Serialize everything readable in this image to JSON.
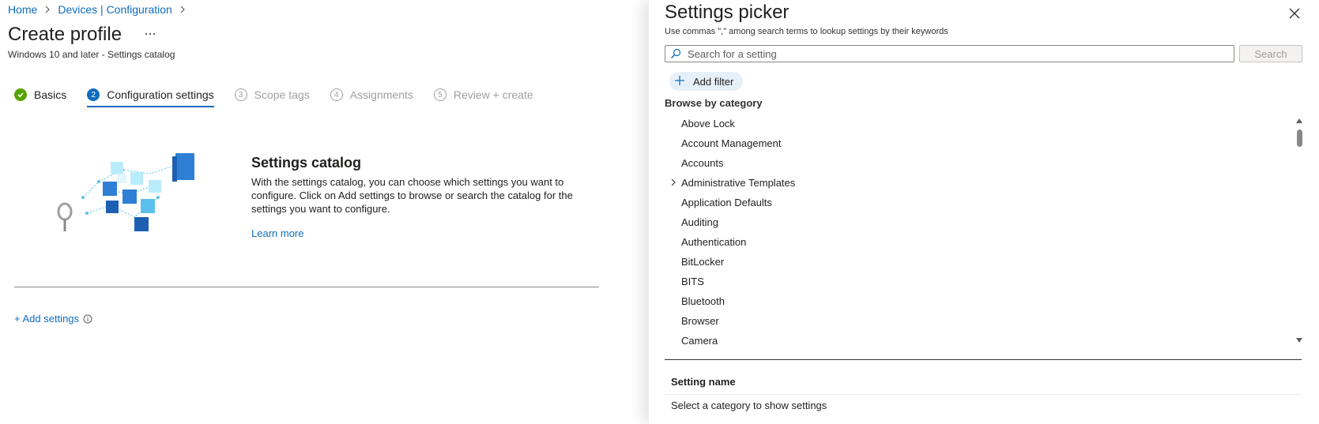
{
  "breadcrumb": {
    "home": "Home",
    "devices": "Devices | Configuration"
  },
  "page": {
    "title": "Create profile",
    "subtitle": "Windows 10 and later - Settings catalog"
  },
  "steps": [
    {
      "num": "✓",
      "label": "Basics",
      "state": "done"
    },
    {
      "num": "2",
      "label": "Configuration settings",
      "state": "active"
    },
    {
      "num": "3",
      "label": "Scope tags",
      "state": "pending"
    },
    {
      "num": "4",
      "label": "Assignments",
      "state": "pending"
    },
    {
      "num": "5",
      "label": "Review + create",
      "state": "pending"
    }
  ],
  "catalog": {
    "title": "Settings catalog",
    "description": "With the settings catalog, you can choose which settings you want to configure. Click on Add settings to browse or search the catalog for the settings you want to configure.",
    "learn_more": "Learn more",
    "add_settings": "+ Add settings"
  },
  "picker": {
    "title": "Settings picker",
    "hint": "Use commas \",\" among search terms to lookup settings by their keywords",
    "search_placeholder": "Search for a setting",
    "search_button": "Search",
    "add_filter": "Add filter",
    "browse_label": "Browse by category",
    "categories": [
      {
        "label": "Above Lock",
        "expandable": false
      },
      {
        "label": "Account Management",
        "expandable": false
      },
      {
        "label": "Accounts",
        "expandable": false
      },
      {
        "label": "Administrative Templates",
        "expandable": true
      },
      {
        "label": "Application Defaults",
        "expandable": false
      },
      {
        "label": "Auditing",
        "expandable": false
      },
      {
        "label": "Authentication",
        "expandable": false
      },
      {
        "label": "BitLocker",
        "expandable": false
      },
      {
        "label": "BITS",
        "expandable": false
      },
      {
        "label": "Bluetooth",
        "expandable": false
      },
      {
        "label": "Browser",
        "expandable": false
      },
      {
        "label": "Camera",
        "expandable": false
      }
    ],
    "column_header": "Setting name",
    "empty_message": "Select a category to show settings"
  },
  "colors": {
    "accent": "#0f6cbd",
    "success": "#57a300",
    "disabled": "#a19f9d"
  },
  "icons": {
    "more": "ellipsis-icon",
    "close": "close-icon",
    "search": "search-icon",
    "add": "plus-icon",
    "info": "info-icon",
    "chevron": "chevron-right-icon"
  }
}
